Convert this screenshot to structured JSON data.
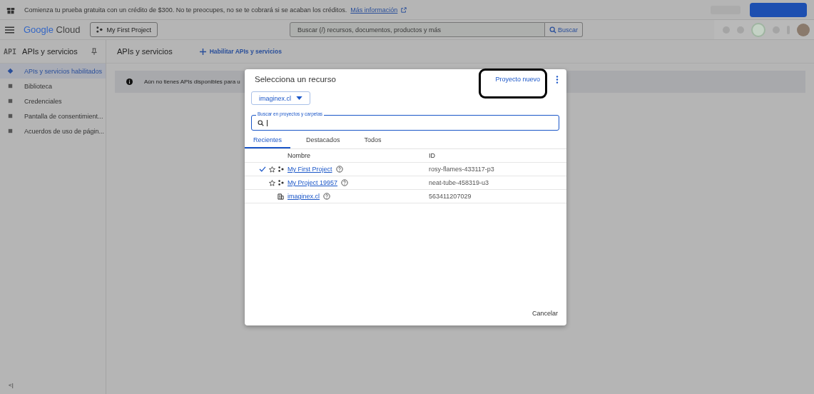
{
  "banner": {
    "text": "Comienza tu prueba gratuita con un crédito de $300. No te preocupes, no se te cobrará si se acaban los créditos.",
    "link": "Más información"
  },
  "header": {
    "logo_google": "Google",
    "logo_cloud": "Cloud",
    "project": "My First Project",
    "search_placeholder": "Buscar (/) recursos, documentos, productos y más",
    "search_button": "Buscar"
  },
  "sidebar": {
    "badge": "API",
    "title": "APIs y servicios",
    "items": [
      {
        "label": "APIs y servicios habilitados",
        "selected": true
      },
      {
        "label": "Biblioteca",
        "selected": false
      },
      {
        "label": "Credenciales",
        "selected": false
      },
      {
        "label": "Pantalla de consentimient...",
        "selected": false
      },
      {
        "label": "Acuerdos de uso de págin...",
        "selected": false
      }
    ],
    "collapse": "<|"
  },
  "main": {
    "title": "APIs y servicios",
    "action": "Habilitar APIs y servicios",
    "notice": "Aún no tienes APIs disponibles para u"
  },
  "dialog": {
    "title": "Selecciona un recurso",
    "new_project": "Proyecto nuevo",
    "org": "imaginex.cl",
    "search_label": "Buscar en proyectos y carpetas",
    "tabs": [
      {
        "label": "Recientes",
        "selected": true
      },
      {
        "label": "Destacados",
        "selected": false
      },
      {
        "label": "Todos",
        "selected": false
      }
    ],
    "columns": [
      "Nombre",
      "ID"
    ],
    "rows": [
      {
        "kind": "project",
        "selected": true,
        "name": "My First Project",
        "id": "rosy-flames-433117-p3"
      },
      {
        "kind": "project",
        "selected": false,
        "name": "My Project 19957",
        "id": "neat-tube-458319-u3"
      },
      {
        "kind": "organization",
        "selected": false,
        "name": "imaginex.cl",
        "id": "563411207029"
      }
    ],
    "cancel": "Cancelar"
  }
}
